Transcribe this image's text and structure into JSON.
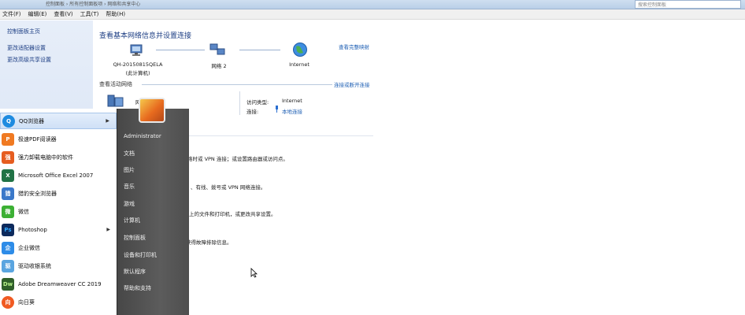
{
  "menubar": {
    "items": [
      "文件(F)",
      "编辑(E)",
      "查看(V)",
      "工具(T)",
      "帮助(H)"
    ]
  },
  "address": {
    "crumb": "控制面板 › 所有控制面板项 › 网络和共享中心",
    "search_placeholder": "搜索控制面板"
  },
  "leftpane": {
    "items": [
      "控制面板主页",
      "更改适配器设置",
      "更改高级共享设置"
    ]
  },
  "main": {
    "title": "查看基本网络信息并设置连接",
    "full_map": "查看完整映射",
    "nodes": {
      "computer": "QH-20150815QELA",
      "computer_sub": "(此计算机)",
      "network": "网络 2",
      "internet": "Internet"
    },
    "active_section": "查看活动网络",
    "connect_link": "连接或断开连接",
    "active_net_partial": "网",
    "access_type_label": "访问类型:",
    "access_type_value": "Internet",
    "connection_label": "连接:",
    "connection_value": "本地连接",
    "tasks": [
      "络时或 VPN 连接；或设置路由器或访问点。",
      "、有线、拨号或 VPN 网络连接。",
      "上的文件和打印机，或更改共享设置。",
      "获得故障排除信息。"
    ]
  },
  "start_menu": {
    "programs": [
      {
        "label": "QQ浏览器",
        "has_arrow": true,
        "color": "#1e8be0",
        "glyph": "Q"
      },
      {
        "label": "极速PDF阅读器",
        "has_arrow": false,
        "color": "#f07a22",
        "glyph": "P"
      },
      {
        "label": "强力卸载电脑中的软件",
        "has_arrow": false,
        "color": "#e65d20",
        "glyph": "强"
      },
      {
        "label": "Microsoft Office Excel 2007",
        "has_arrow": false,
        "color": "#217346",
        "glyph": "X"
      },
      {
        "label": "猎豹安全浏览器",
        "has_arrow": false,
        "color": "#3a78c9",
        "glyph": "猎"
      },
      {
        "label": "微信",
        "has_arrow": false,
        "color": "#3cb034",
        "glyph": "微"
      },
      {
        "label": "Photoshop",
        "has_arrow": true,
        "color": "#0d2a5c",
        "glyph": "Ps"
      },
      {
        "label": "企业微信",
        "has_arrow": false,
        "color": "#2d8ce8",
        "glyph": "企"
      },
      {
        "label": "驱动收银系统",
        "has_arrow": false,
        "color": "#5aa5e0",
        "glyph": "驱"
      },
      {
        "label": "Adobe Dreamweaver CC 2019",
        "has_arrow": false,
        "color": "#2f5f2a",
        "glyph": "Dw"
      },
      {
        "label": "向日葵",
        "has_arrow": false,
        "color": "#f05a22",
        "glyph": "向"
      }
    ],
    "right_items": [
      "Administrator",
      "文档",
      "图片",
      "音乐",
      "游戏",
      "计算机",
      "控制面板",
      "设备和打印机",
      "默认程序",
      "帮助和支持"
    ]
  }
}
